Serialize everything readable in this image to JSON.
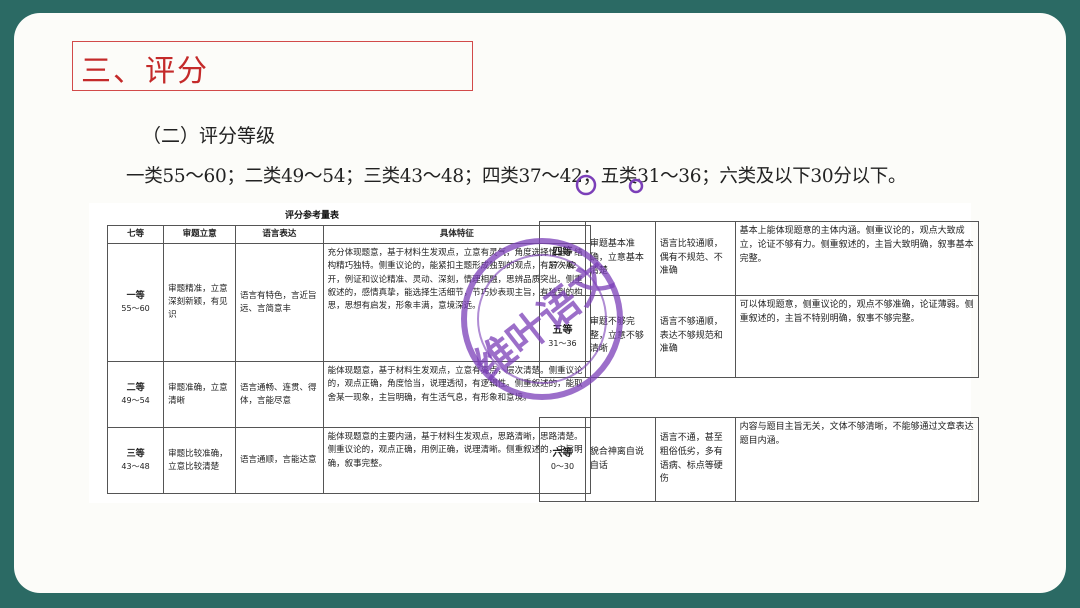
{
  "section_title": "三、评分",
  "subtitle": "（二）评分等级",
  "categories_line": "一类55～60；二类49～54；三类43～48；四类37～42；五类31～36；六类及以下30分以下。",
  "scan": {
    "table_title": "评分参考量表",
    "left_headers": [
      "七等",
      "审题立意",
      "语言表达",
      "具体特征"
    ],
    "left_rows": [
      {
        "grade": "一等",
        "range": "55～60",
        "c1": "审题精准，立意深刻新颖，有见识",
        "c2": "语言有特色，言近旨远、言简意丰",
        "c3": "充分体现题意，基于材料生发观点，立意有灵气，角度选择恰当，结构精巧独特。侧重议论的，能紧扣主题形成独到的观点，有层次展开，例证和议论精准、灵动、深刻，情理相融，思辨品质突出。侧重叙述的，感情真挚，能选择生活细节，节巧妙表现主旨，有独到的构思，思想有启发，形象丰满，意境深远。"
      },
      {
        "grade": "二等",
        "range": "49～54",
        "c1": "审题准确，立意清晰",
        "c2": "语言通畅、连贯、得体，言能尽意",
        "c3": "能体现题意，基于材料生发观点，立意有亮点，层次清楚。侧重议论的，观点正确，角度恰当，说理透彻，有逻辑性。侧重叙述的，能取舍某一现象，主旨明确，有生活气息，有形象和意境。"
      },
      {
        "grade": "三等",
        "range": "43～48",
        "c1": "审题比较准确，立意比较清楚",
        "c2": "语言通顺，言能达意",
        "c3": "能体现题意的主要内涵，基于材料生发观点，思路清晰，思路清楚。侧重议论的，观点正确，用例正确，说理清晰。侧重叙述的，主旨明确，叙事完整。"
      }
    ],
    "right_rows": [
      {
        "grade": "四等",
        "range": "37～42",
        "c1": "审题基本准确，立意基本清楚",
        "c2": "语言比较通顺，偶有不规范、不准确",
        "c3": "基本上能体现题意的主体内涵。侧重议论的，观点大致成立，论证不够有力。侧重叙述的，主旨大致明确，叙事基本完整。"
      },
      {
        "grade": "五等",
        "range": "31～36",
        "c1": "审题不够完整，立意不够清晰",
        "c2": "语言不够通顺，表达不够规范和准确",
        "c3": "可以体现题意，侧重议论的，观点不够准确，论证薄弱。侧重叙述的，主旨不特别明确，叙事不够完整。"
      },
      {
        "grade": "六等",
        "range": "0～30",
        "c1": "貌合神离自说自话",
        "c2": "语言不通，甚至粗俗低劣，多有语病、标点等硬伤",
        "c3": "内容与题目主旨无关，文体不够清晰，不能够通过文章表达题目内涵。"
      }
    ],
    "watermark_text": "维叶语文"
  },
  "colors": {
    "frame": "#2b6a64",
    "slide_bg": "#fcfcf9",
    "title_red": "#c42a2a",
    "stamp_purple": "#7b3fb8"
  }
}
